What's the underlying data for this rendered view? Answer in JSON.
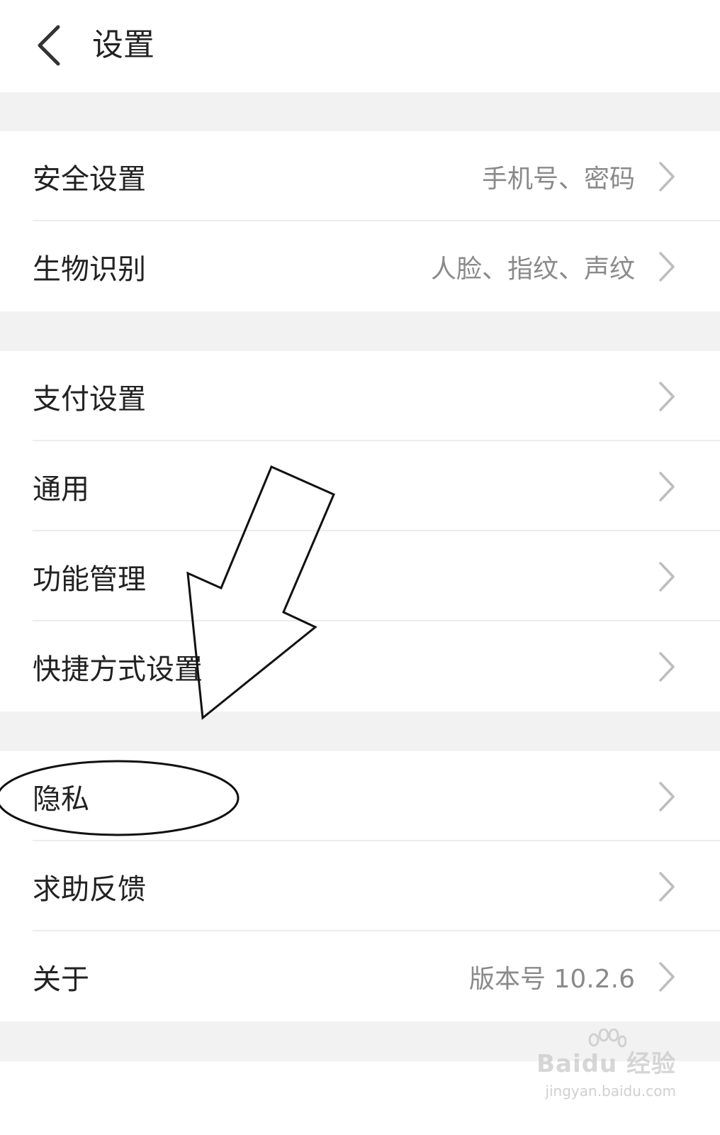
{
  "header": {
    "title": "设置",
    "back_icon": "chevron-left-icon"
  },
  "groups": [
    {
      "items": [
        {
          "label": "安全设置",
          "value": "手机号、密码"
        },
        {
          "label": "生物识别",
          "value": "人脸、指纹、声纹"
        }
      ]
    },
    {
      "items": [
        {
          "label": "支付设置",
          "value": ""
        },
        {
          "label": "通用",
          "value": ""
        },
        {
          "label": "功能管理",
          "value": ""
        },
        {
          "label": "快捷方式设置",
          "value": ""
        }
      ]
    },
    {
      "items": [
        {
          "label": "隐私",
          "value": ""
        },
        {
          "label": "求助反馈",
          "value": ""
        },
        {
          "label": "关于",
          "value": "版本号 10.2.6"
        }
      ]
    }
  ],
  "watermark": {
    "brand": "Baidu 经验",
    "url": "jingyan.baidu.com"
  },
  "colors": {
    "background": "#ffffff",
    "section_gap": "#f2f2f2",
    "text": "#222222",
    "secondary_text": "#8a8a8a",
    "chevron": "#bdbdbd"
  }
}
